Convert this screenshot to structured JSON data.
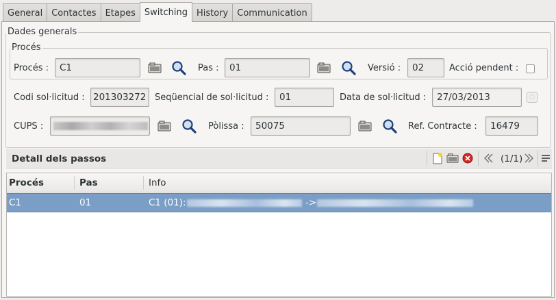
{
  "tabs": [
    {
      "label": "General"
    },
    {
      "label": "Contactes"
    },
    {
      "label": "Etapes"
    },
    {
      "label": "Switching",
      "active": true
    },
    {
      "label": "History"
    },
    {
      "label": "Communication"
    }
  ],
  "dades_generals": {
    "legend": "Dades generals",
    "proces_group": {
      "legend": "Procés",
      "proces_label": "Procés :",
      "proces_value": "C1",
      "pas_label": "Pas :",
      "pas_value": "01",
      "versio_label": "Versió :",
      "versio_value": "02",
      "accio_label": "Acció pendent :",
      "accio_checked": false
    },
    "codi_label": "Codi sol·licitud :",
    "codi_value": "201303272",
    "sequencial_label": "Seqüencial de sol·licitud :",
    "sequencial_value": "01",
    "data_label": "Data de sol·licitud :",
    "data_value": "27/03/2013",
    "cups_label": "CUPS :",
    "polissa_label": "Pòlissa :",
    "polissa_value": "50075",
    "ref_label": "Ref. Contracte :",
    "ref_value": "16479"
  },
  "detall": {
    "title": "Detall dels passos",
    "pager": "(1/1)",
    "columns": [
      "Procés",
      "Pas",
      "Info"
    ],
    "rows": [
      {
        "proces": "C1",
        "pas": "01",
        "info_prefix": "C1 (01):",
        "info_arrow": "->"
      }
    ]
  },
  "icons": {
    "open": "folder-open-icon",
    "search": "magnifier-icon",
    "new": "new-document-icon",
    "delete": "delete-icon",
    "prev": "previous-icon",
    "next": "next-icon",
    "menu": "menu-icon"
  },
  "colors": {
    "selection": "#7a9ec6",
    "background": "#edeceb"
  }
}
